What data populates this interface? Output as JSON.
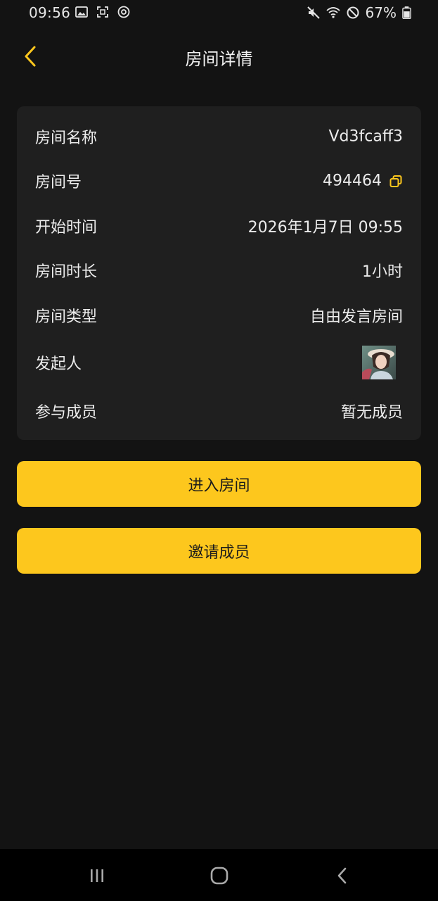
{
  "status_bar": {
    "time": "09:56",
    "battery": "67%",
    "left_icons": [
      "image-icon",
      "screenshot-icon",
      "sync-icon"
    ],
    "right_icons": [
      "mute-icon",
      "wifi-icon",
      "do-not-disturb-icon",
      "battery-icon"
    ]
  },
  "header": {
    "title": "房间详情",
    "back_icon": "chevron-left-icon"
  },
  "details": {
    "room_name": {
      "label": "房间名称",
      "value": "Vd3fcaff3"
    },
    "room_number": {
      "label": "房间号",
      "value": "494464",
      "icon": "copy-icon"
    },
    "start_time": {
      "label": "开始时间",
      "value": "2026年1月7日 09:55"
    },
    "duration": {
      "label": "房间时长",
      "value": "1小时"
    },
    "room_type": {
      "label": "房间类型",
      "value": "自由发言房间"
    },
    "initiator": {
      "label": "发起人"
    },
    "participants": {
      "label": "参与成员",
      "value": "暂无成员"
    }
  },
  "actions": {
    "enter_label": "进入房间",
    "invite_label": "邀请成员"
  },
  "colors": {
    "accent": "#fdc71d",
    "background": "#131313",
    "card": "#1f1f1f"
  },
  "nav_bar": {
    "icons": [
      "recent-apps-icon",
      "home-icon",
      "back-icon"
    ]
  }
}
